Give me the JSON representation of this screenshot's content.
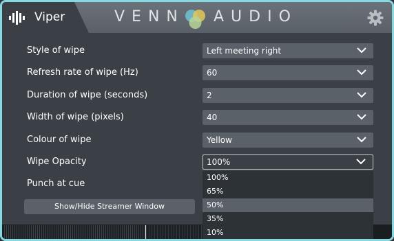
{
  "header": {
    "app_title": "Viper",
    "brand_left": "VENN",
    "brand_right": "AUDIO",
    "icons": [
      "waveform-icon",
      "venn-logo",
      "gear-icon"
    ]
  },
  "settings": {
    "rows": [
      {
        "label": "Style of wipe",
        "value": "Left meeting right"
      },
      {
        "label": "Refresh rate of wipe (Hz)",
        "value": "60"
      },
      {
        "label": "Duration of wipe (seconds)",
        "value": "2"
      },
      {
        "label": "Width of wipe (pixels)",
        "value": "40"
      },
      {
        "label": "Colour of wipe",
        "value": "Yellow"
      },
      {
        "label": "Wipe Opacity",
        "value": "100%"
      }
    ],
    "punch_label": "Punch at cue",
    "streamer_button": "Show/Hide Streamer Window"
  },
  "dropdown": {
    "options": [
      "100%",
      "65%",
      "50%",
      "35%",
      "10%"
    ],
    "highlighted": "50%"
  },
  "colors": {
    "accent_border": "#86d9e0",
    "panel": "#3a4046",
    "control": "#5b6168"
  }
}
